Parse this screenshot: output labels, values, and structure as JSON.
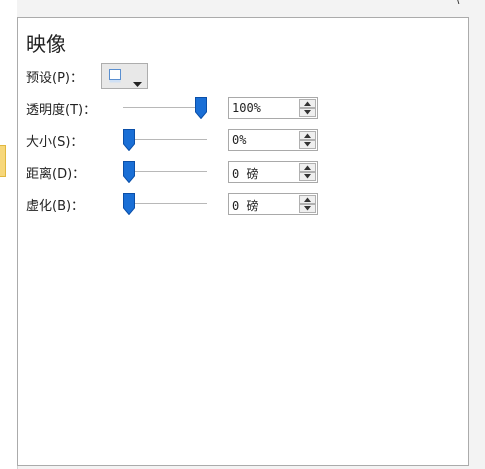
{
  "top_glyphs": [
    "'",
    "\\"
  ],
  "panel": {
    "title": "映像"
  },
  "preset": {
    "label": "预设(P)：",
    "icon": "reflection-preset-icon",
    "dropdown_icon": "chevron-down-icon"
  },
  "rows": [
    {
      "key": "transparency",
      "label": "透明度(T)：",
      "value": "100%",
      "level_percent": 100
    },
    {
      "key": "size",
      "label": "大小(S)：",
      "value": "0%",
      "level_percent": 0
    },
    {
      "key": "distance",
      "label": "距离(D)：",
      "value": "0 磅",
      "level_percent": 0
    },
    {
      "key": "blur",
      "label": "虚化(B)：",
      "value": "0 磅",
      "level_percent": 0
    }
  ],
  "colors": {
    "slider_thumb": "#1a6fd6",
    "panel_border": "#ababab",
    "left_tab": "#f7d77a"
  }
}
